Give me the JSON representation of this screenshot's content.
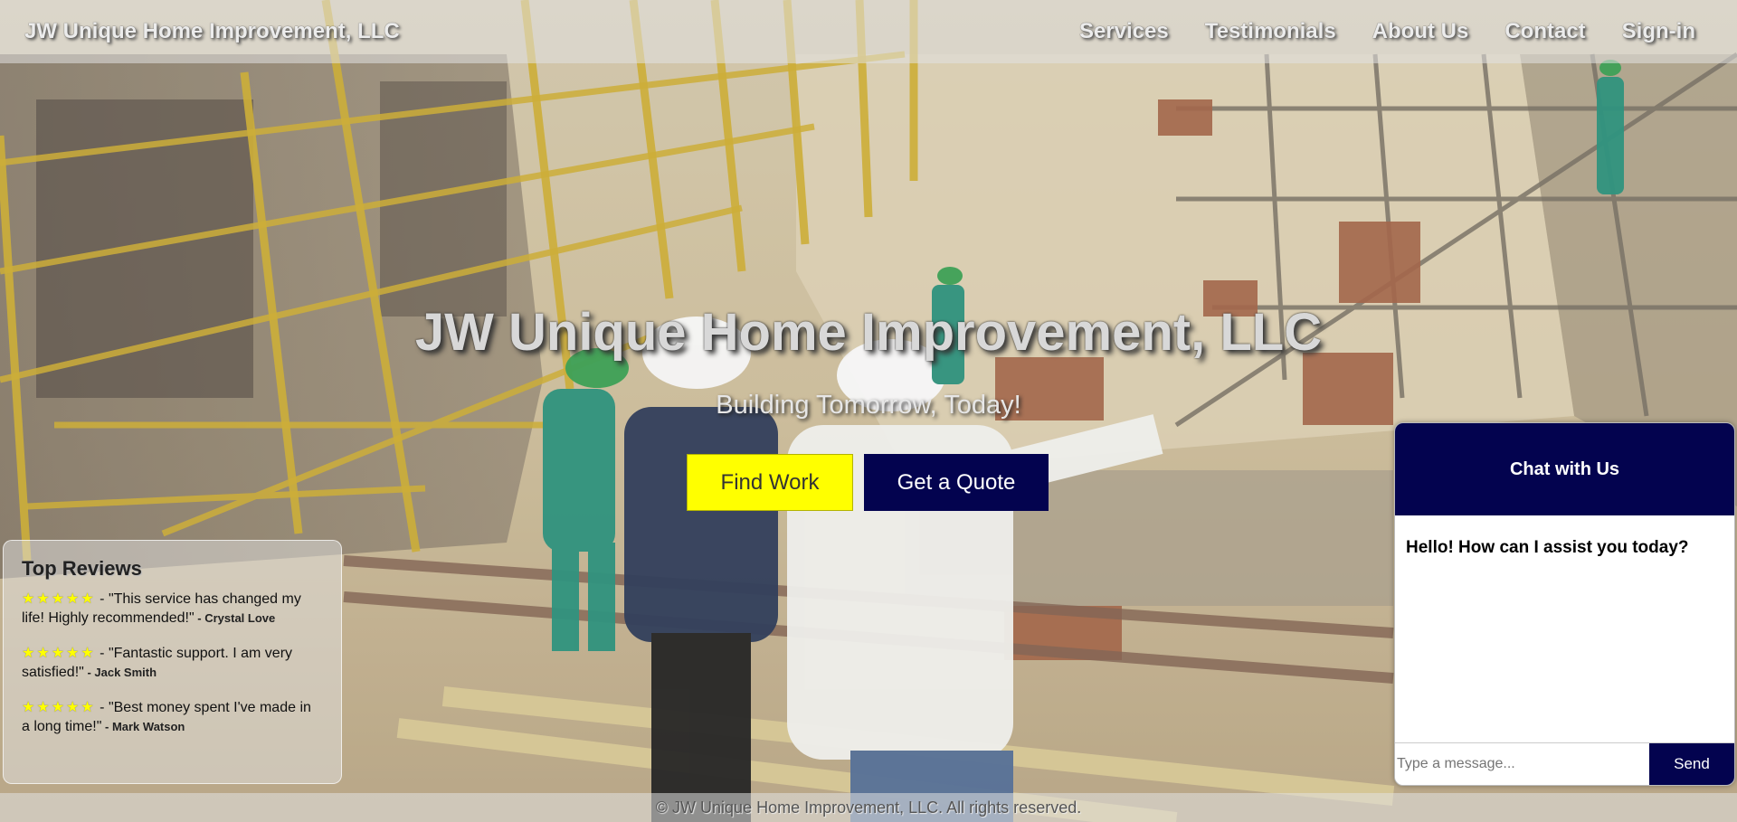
{
  "header": {
    "brand": "JW Unique Home Improvement, LLC",
    "nav": [
      "Services",
      "Testimonials",
      "About Us",
      "Contact",
      "Sign-in"
    ]
  },
  "hero": {
    "title": "JW Unique Home Improvement, LLC",
    "subtitle": "Building Tomorrow, Today!",
    "find_work_label": "Find Work",
    "quote_label": "Get a Quote",
    "background_image": "construction-site-photo"
  },
  "reviews": {
    "title": "Top Reviews",
    "items": [
      {
        "stars": "★★★★★",
        "text": " - \"This service has changed my life! Highly recommended!\"",
        "author": " - Crystal Love"
      },
      {
        "stars": "★★★★★",
        "text": " - \"Fantastic support. I am very satisfied!\"",
        "author": " - Jack Smith"
      },
      {
        "stars": "★★★★★",
        "text": " - \"Best money spent I've made in a long time!\"",
        "author": " - Mark Watson"
      }
    ]
  },
  "chat": {
    "title": "Chat with Us",
    "greeting": "Hello! How can I assist you today?",
    "input_placeholder": "Type a message...",
    "send_label": "Send"
  },
  "footer": {
    "text": "© JW Unique Home Improvement, LLC. All rights reserved."
  },
  "colors": {
    "primary_navy": "#03034f",
    "accent_yellow": "#ffff00"
  }
}
